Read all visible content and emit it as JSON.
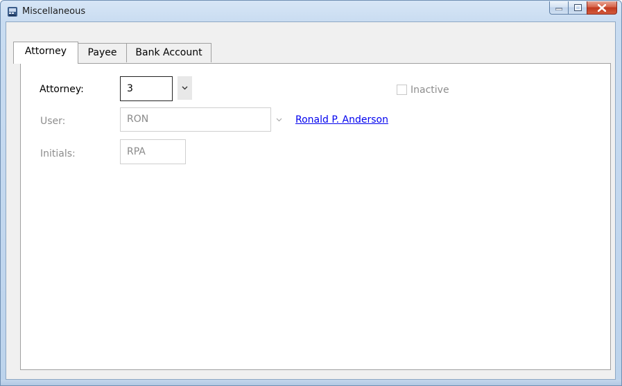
{
  "window": {
    "title": "Miscellaneous",
    "icons": {
      "app": "cash-register-icon",
      "minimize": "minimize-icon",
      "maximize": "maximize-icon",
      "close": "close-icon"
    }
  },
  "tabs": [
    {
      "label": "Attorney",
      "active": true
    },
    {
      "label": "Payee",
      "active": false
    },
    {
      "label": "Bank Account",
      "active": false
    }
  ],
  "form": {
    "attorney": {
      "label": "Attorney:",
      "value": "3"
    },
    "inactive": {
      "label": "Inactive",
      "checked": false
    },
    "user": {
      "label": "User:",
      "value": "RON",
      "link": "Ronald P. Anderson"
    },
    "initials": {
      "label": "Initials:",
      "value": "RPA"
    }
  },
  "colors": {
    "accent_link": "#0000ee",
    "close_button": "#c0391f",
    "title_bar": "#c9dcf1"
  }
}
